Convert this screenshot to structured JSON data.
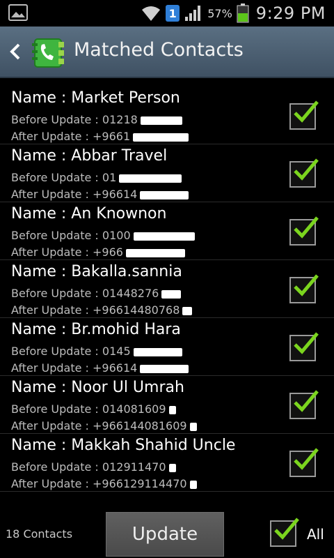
{
  "status_bar": {
    "sim_badge": "1",
    "battery": "57%",
    "time": "9:29 PM",
    "icons": [
      "gallery-icon",
      "wifi-icon",
      "signal-icon",
      "battery-icon"
    ],
    "battery_color": "#5cc51a"
  },
  "action_bar": {
    "title": "Matched Contacts",
    "icons": [
      "back-icon",
      "contacts-app-icon"
    ],
    "app_icon_color": "#3fb53f"
  },
  "contacts": [
    {
      "name": "Name : Market Person",
      "before": "Before Update : 01218",
      "after": "After Update : +9661",
      "checked": true
    },
    {
      "name": "Name : Abbar Travel",
      "before": "Before Update : 01",
      "after": "After Update : +96614",
      "checked": true
    },
    {
      "name": "Name : An Knownon",
      "before": "Before Update : 0100",
      "after": "After Update : +966",
      "checked": true
    },
    {
      "name": "Name : Bakalla.sannia",
      "before": "Before Update : 01448276",
      "after": "After Update : +96614480768",
      "checked": true
    },
    {
      "name": "Name : Br.mohid Hara",
      "before": "Before Update : 0145",
      "after": "After Update : +96614",
      "checked": true
    },
    {
      "name": "Name : Noor Ul Umrah",
      "before": "Before Update : 014081609",
      "after": "After Update : +966144081609",
      "checked": true
    },
    {
      "name": "Name : Makkah Shahid Uncle",
      "before": "Before Update : 012911470",
      "after": "After Update : +966129114470",
      "checked": true
    }
  ],
  "footer": {
    "count": "18 Contacts",
    "update_label": "Update",
    "all_label": "All",
    "all_checked": true
  },
  "colors": {
    "check": "#7bd51e",
    "action_bar": "#4f6376"
  }
}
